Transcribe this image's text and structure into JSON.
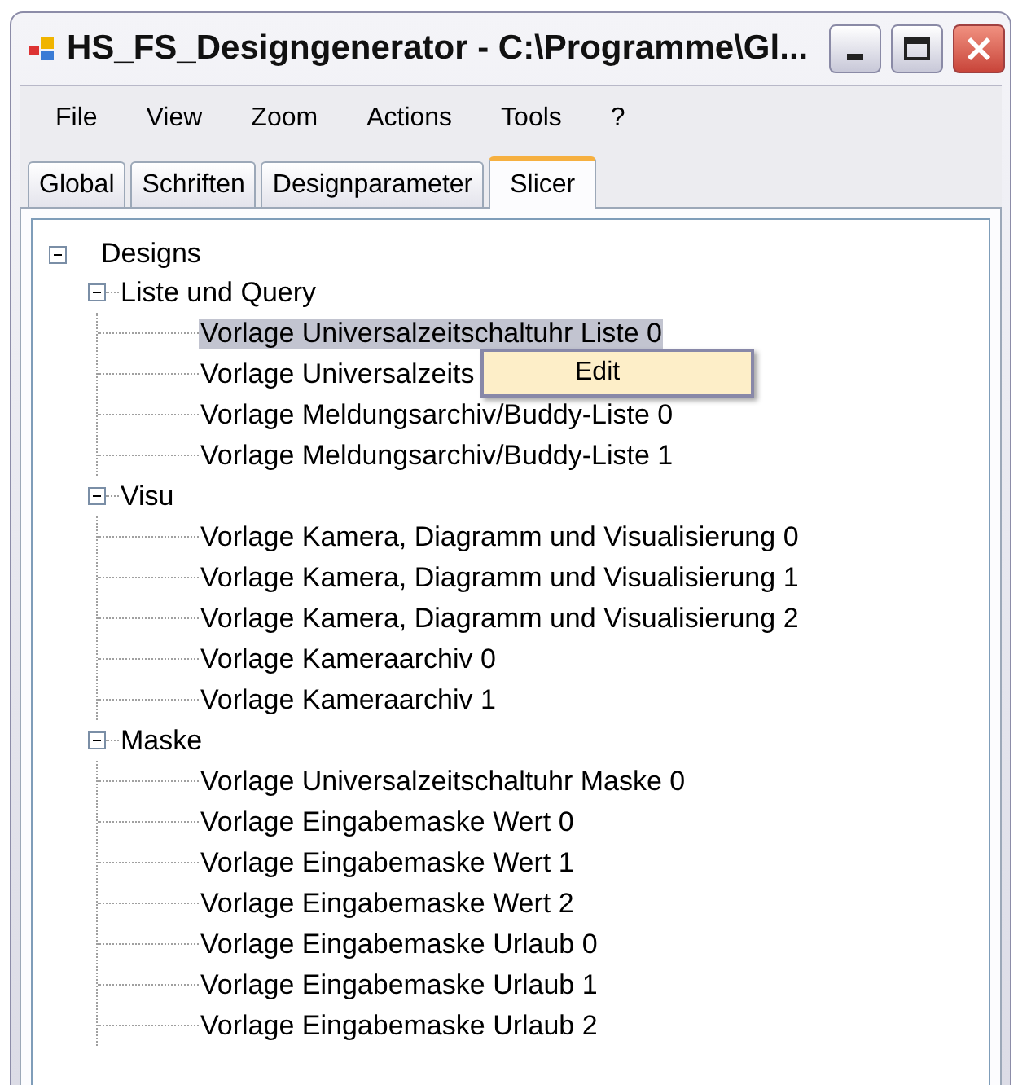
{
  "window": {
    "title": "HS_FS_Designgenerator - C:\\Programme\\Gl..."
  },
  "menu": [
    "File",
    "View",
    "Zoom",
    "Actions",
    "Tools",
    "?"
  ],
  "tabs": [
    {
      "label": "Global",
      "selected": false
    },
    {
      "label": "Schriften",
      "selected": false
    },
    {
      "label": "Designparameter",
      "selected": false
    },
    {
      "label": "Slicer",
      "selected": true
    }
  ],
  "tree": [
    {
      "label": "Designs",
      "expanded": true,
      "selected": false,
      "children": [
        {
          "label": "Liste und Query",
          "expanded": true,
          "selected": false,
          "children": [
            {
              "label": "Vorlage Universalzeitschaltuhr Liste 0",
              "selected": true
            },
            {
              "label": "Vorlage Universalzeits",
              "selected": false
            },
            {
              "label": "Vorlage Meldungsarchiv/Buddy-Liste 0",
              "selected": false
            },
            {
              "label": "Vorlage Meldungsarchiv/Buddy-Liste 1",
              "selected": false
            }
          ]
        },
        {
          "label": "Visu",
          "expanded": true,
          "selected": false,
          "children": [
            {
              "label": "Vorlage Kamera, Diagramm und Visualisierung 0",
              "selected": false
            },
            {
              "label": "Vorlage Kamera, Diagramm und Visualisierung 1",
              "selected": false
            },
            {
              "label": "Vorlage Kamera, Diagramm und Visualisierung 2",
              "selected": false
            },
            {
              "label": "Vorlage Kameraarchiv 0",
              "selected": false
            },
            {
              "label": "Vorlage Kameraarchiv 1",
              "selected": false
            }
          ]
        },
        {
          "label": "Maske",
          "expanded": true,
          "selected": false,
          "children": [
            {
              "label": "Vorlage Universalzeitschaltuhr Maske 0",
              "selected": false
            },
            {
              "label": "Vorlage Eingabemaske Wert 0",
              "selected": false
            },
            {
              "label": "Vorlage Eingabemaske Wert 1",
              "selected": false
            },
            {
              "label": "Vorlage Eingabemaske Wert 2",
              "selected": false
            },
            {
              "label": "Vorlage Eingabemaske Urlaub 0",
              "selected": false
            },
            {
              "label": "Vorlage Eingabemaske Urlaub 1",
              "selected": false
            },
            {
              "label": "Vorlage Eingabemaske Urlaub 2",
              "selected": false
            }
          ]
        }
      ]
    }
  ],
  "context_menu": {
    "items": [
      {
        "label": "Edit"
      }
    ]
  }
}
